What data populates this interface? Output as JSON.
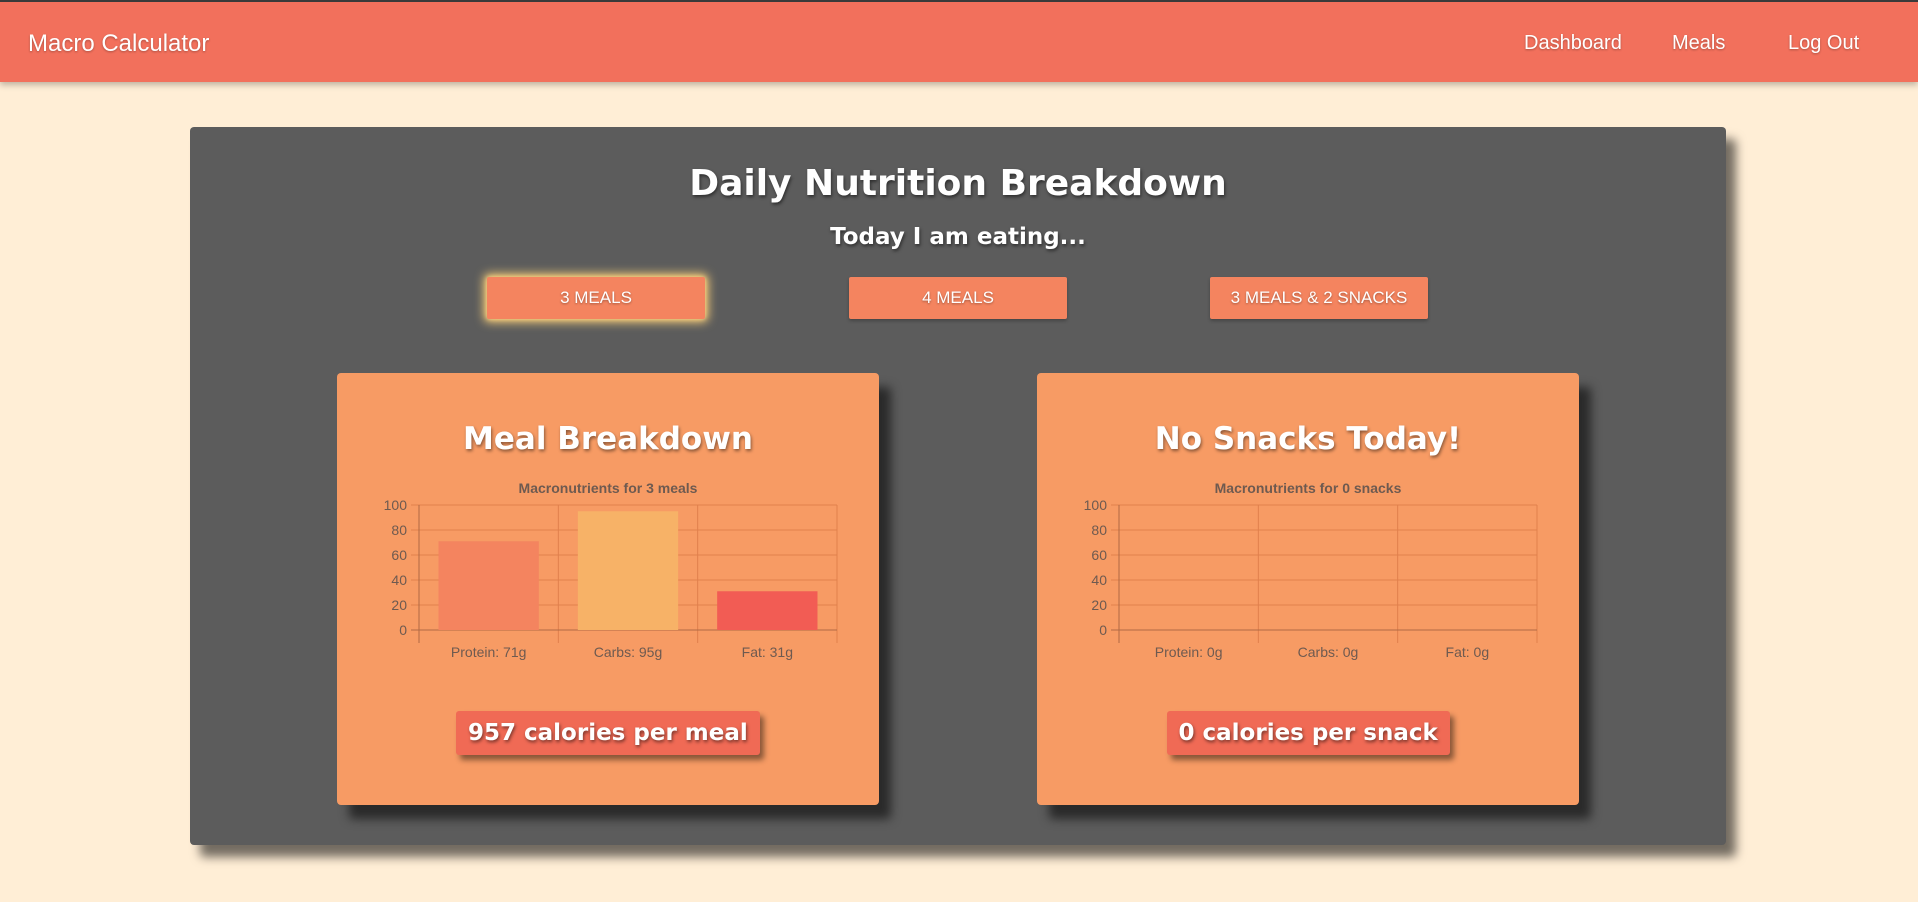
{
  "navbar": {
    "brand": "Macro Calculator",
    "links": [
      "Dashboard",
      "Meals",
      "Log Out"
    ]
  },
  "panel": {
    "title": "Daily Nutrition Breakdown",
    "subtitle": "Today I am eating...",
    "choices": [
      "3 MEALS",
      "4 MEALS",
      "3 MEALS & 2 SNACKS"
    ],
    "selected_choice": "3 MEALS"
  },
  "meal_card": {
    "title": "Meal Breakdown",
    "calories_label": "957 calories per meal"
  },
  "snack_card": {
    "title": "No Snacks Today!",
    "calories_label": "0 calories per snack"
  },
  "colors": {
    "navbar": "#f2705c",
    "page_background": "#ffeed6",
    "panel": "#5c5c5c",
    "card": "#f79b64",
    "button": "#f4845f",
    "badge": "#f06a55",
    "protein": "#f4845f",
    "carbs": "#f7b267",
    "fat": "#f25c54"
  },
  "chart_data": [
    {
      "type": "bar",
      "title": "Macronutrients for 3 meals",
      "categories": [
        "Protein: 71g",
        "Carbs: 95g",
        "Fat: 31g"
      ],
      "values": [
        71,
        95,
        31
      ],
      "bar_colors": [
        "#f4845f",
        "#f7b267",
        "#f25c54"
      ],
      "ylim": [
        0,
        100
      ],
      "yticks": [
        0,
        20,
        40,
        60,
        80,
        100
      ],
      "grid": true,
      "legend": false
    },
    {
      "type": "bar",
      "title": "Macronutrients for 0 snacks",
      "categories": [
        "Protein: 0g",
        "Carbs: 0g",
        "Fat: 0g"
      ],
      "values": [
        0,
        0,
        0
      ],
      "bar_colors": [
        "#f4845f",
        "#f7b267",
        "#f25c54"
      ],
      "ylim": [
        0,
        100
      ],
      "yticks": [
        0,
        20,
        40,
        60,
        80,
        100
      ],
      "grid": true,
      "legend": false
    }
  ]
}
